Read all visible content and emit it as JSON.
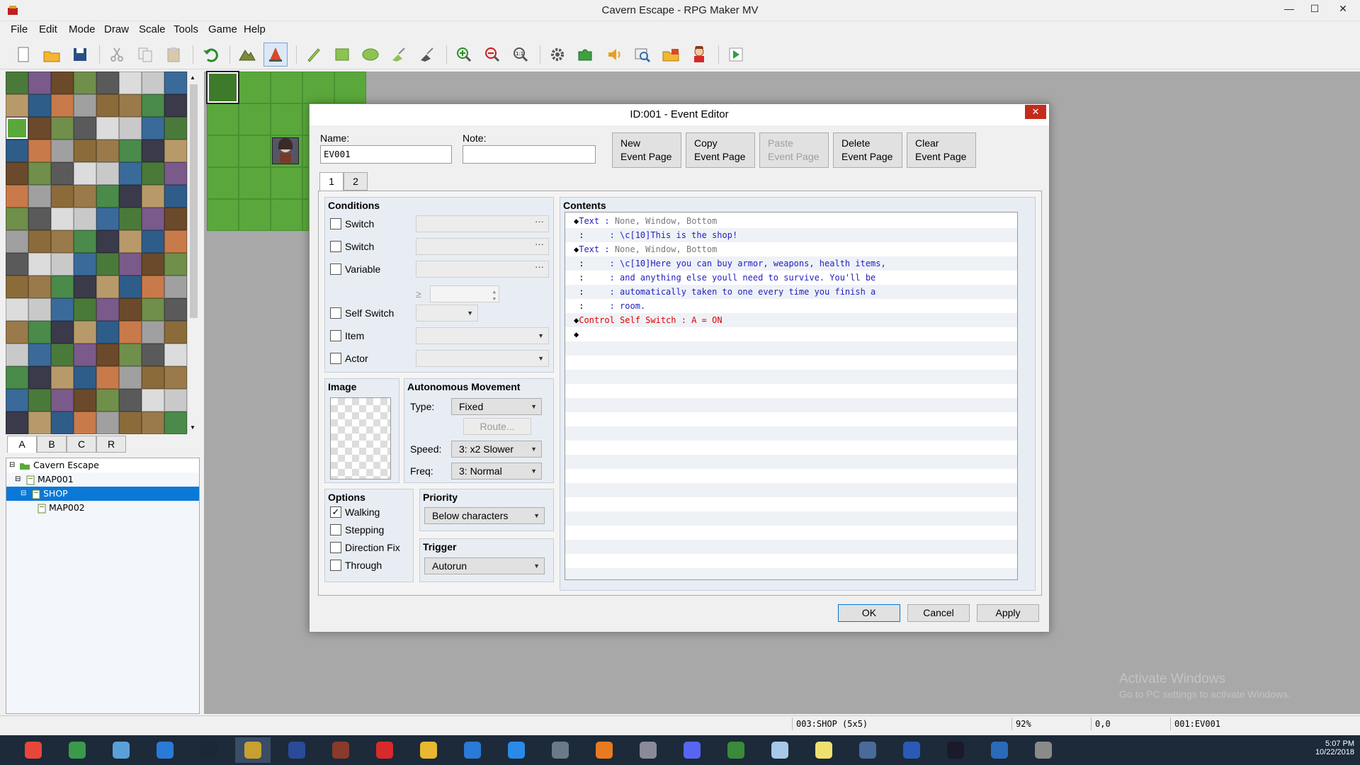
{
  "window": {
    "title": "Cavern Escape - RPG Maker MV",
    "minimize": "—",
    "maximize": "☐",
    "close": "✕"
  },
  "menu": [
    "File",
    "Edit",
    "Mode",
    "Draw",
    "Scale",
    "Tools",
    "Game",
    "Help"
  ],
  "toolbar_icons": [
    "new-project-icon",
    "open-project-icon",
    "save-project-icon",
    "cut-icon",
    "copy-icon",
    "paste-icon",
    "undo-icon",
    "map-mode-icon",
    "event-mode-icon",
    "pencil-icon",
    "rectangle-icon",
    "ellipse-icon",
    "fill-icon",
    "shadow-pen-icon",
    "zoom-in-icon",
    "zoom-out-icon",
    "actual-size-icon",
    "database-icon",
    "plugin-manager-icon",
    "sound-test-icon",
    "event-searcher-icon",
    "resource-manager-icon",
    "character-generator-icon",
    "playtest-icon"
  ],
  "tileset_tabs": [
    "A",
    "B",
    "C",
    "R"
  ],
  "map_tree": [
    {
      "label": "Cavern Escape",
      "level": 0,
      "selected": false,
      "expand": "⊟"
    },
    {
      "label": "MAP001",
      "level": 1,
      "selected": false,
      "expand": "⊟"
    },
    {
      "label": "SHOP",
      "level": 2,
      "selected": true,
      "expand": "⊟"
    },
    {
      "label": "MAP002",
      "level": 3,
      "selected": false,
      "expand": ""
    }
  ],
  "status": {
    "map": "003:SHOP (5x5)",
    "zoom": "92%",
    "coords": "0,0",
    "event": "001:EV001"
  },
  "watermark": {
    "line1": "Activate Windows",
    "line2": "Go to PC settings to activate Windows."
  },
  "dialog": {
    "title": "ID:001 - Event Editor",
    "close": "✕",
    "name_label": "Name:",
    "name_value": "EV001",
    "note_label": "Note:",
    "note_value": "",
    "page_buttons": [
      {
        "line1": "New",
        "line2": "Event Page",
        "disabled": false
      },
      {
        "line1": "Copy",
        "line2": "Event Page",
        "disabled": false
      },
      {
        "line1": "Paste",
        "line2": "Event Page",
        "disabled": true
      },
      {
        "line1": "Delete",
        "line2": "Event Page",
        "disabled": false
      },
      {
        "line1": "Clear",
        "line2": "Event Page",
        "disabled": false
      }
    ],
    "page_tabs": [
      "1",
      "2"
    ],
    "conditions": {
      "title": "Conditions",
      "switch1": "Switch",
      "switch2": "Switch",
      "variable": "Variable",
      "gte": "≥",
      "self_switch": "Self Switch",
      "item": "Item",
      "actor": "Actor",
      "dots": "···"
    },
    "image": {
      "title": "Image"
    },
    "movement": {
      "title": "Autonomous Movement",
      "type_label": "Type:",
      "type_value": "Fixed",
      "route_button": "Route...",
      "speed_label": "Speed:",
      "speed_value": "3: x2 Slower",
      "freq_label": "Freq:",
      "freq_value": "3: Normal"
    },
    "options": {
      "title": "Options",
      "walking": "Walking",
      "stepping": "Stepping",
      "direction_fix": "Direction Fix",
      "through": "Through",
      "check_mark": "✓"
    },
    "priority": {
      "title": "Priority",
      "value": "Below characters"
    },
    "trigger": {
      "title": "Trigger",
      "value": "Autorun"
    },
    "contents_title": "Contents",
    "contents": [
      {
        "prefix": "◆",
        "cmd": "Text",
        "sep": " : ",
        "args": "None, Window, Bottom",
        "kind": "text-cmd"
      },
      {
        "prefix": " :",
        "cmd": "",
        "sep": "     : ",
        "args": "\\c[10]This is the shop!",
        "kind": "text-line"
      },
      {
        "prefix": "◆",
        "cmd": "Text",
        "sep": " : ",
        "args": "None, Window, Bottom",
        "kind": "text-cmd"
      },
      {
        "prefix": " :",
        "cmd": "",
        "sep": "     : ",
        "args": "\\c[10]Here you can buy armor, weapons, health items,",
        "kind": "text-line"
      },
      {
        "prefix": " :",
        "cmd": "",
        "sep": "     : ",
        "args": "and anything else youll need to survive. You'll be",
        "kind": "text-line"
      },
      {
        "prefix": " :",
        "cmd": "",
        "sep": "     : ",
        "args": "automatically taken to one every time you finish a",
        "kind": "text-line"
      },
      {
        "prefix": " :",
        "cmd": "",
        "sep": "     : ",
        "args": "room.",
        "kind": "text-line"
      },
      {
        "prefix": "◆",
        "cmd": "Control Self Switch",
        "sep": " : ",
        "args": "A = ON",
        "kind": "control-cmd"
      },
      {
        "prefix": "◆",
        "cmd": "",
        "sep": "",
        "args": "",
        "kind": "empty"
      }
    ],
    "ok": "OK",
    "cancel": "Cancel",
    "apply": "Apply"
  },
  "taskbar_icons": [
    "chrome-icon",
    "maps-icon",
    "paint-icon",
    "steam-icon-alt",
    "steam-icon",
    "rpg-maker-icon",
    "photoshop-elements-icon",
    "game-icon",
    "flash-icon",
    "file-explorer-icon",
    "store-icon",
    "zoom-icon",
    "calculator-icon",
    "fl-studio-icon",
    "snipping-tool-icon",
    "discord-icon",
    "xbox-icon",
    "notepad-icon",
    "sticky-notes-icon",
    "photos-icon",
    "word-icon",
    "media-icon",
    "editor-icon",
    "audio-icon"
  ],
  "clock": {
    "time": "5:07 PM",
    "date": "10/22/2018"
  },
  "colors": {
    "selection": "#0a78d7",
    "text_command": "#1f1fbf",
    "control_command": "#e00000",
    "args_gray": "#7a7a7a",
    "grass": "#5aa83c"
  }
}
